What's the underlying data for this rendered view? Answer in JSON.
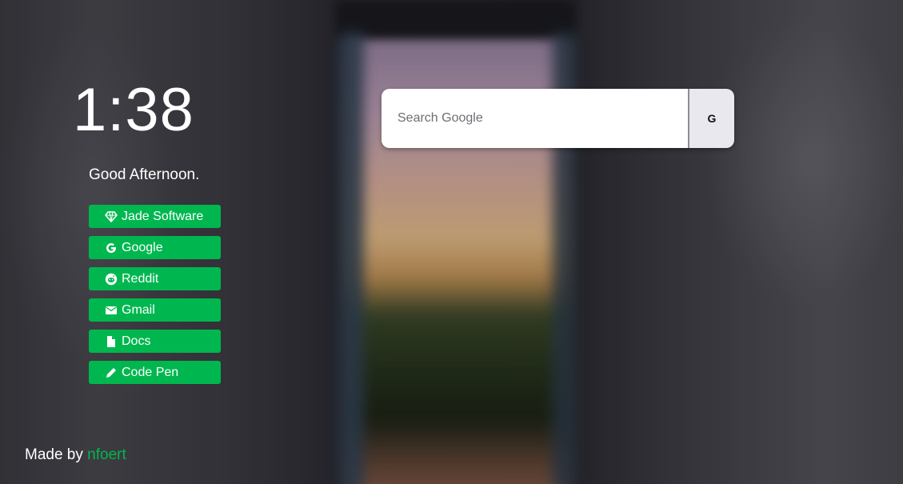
{
  "clock": {
    "time": "1:38"
  },
  "greeting": {
    "text": "Good Afternoon."
  },
  "links": [
    {
      "label": "Jade Software",
      "icon": "diamond-icon"
    },
    {
      "label": "Google",
      "icon": "google-icon"
    },
    {
      "label": "Reddit",
      "icon": "reddit-icon"
    },
    {
      "label": "Gmail",
      "icon": "envelope-icon"
    },
    {
      "label": "Docs",
      "icon": "document-icon"
    },
    {
      "label": "Code Pen",
      "icon": "pencil-icon"
    }
  ],
  "search": {
    "placeholder": "Search Google",
    "value": "",
    "button_label": "G"
  },
  "footer": {
    "prefix": "Made by",
    "author": "nfoert"
  },
  "colors": {
    "accent": "#00b74f",
    "text": "#ffffff",
    "search_bg": "#ffffff",
    "search_button_bg": "#e9e8ee"
  }
}
